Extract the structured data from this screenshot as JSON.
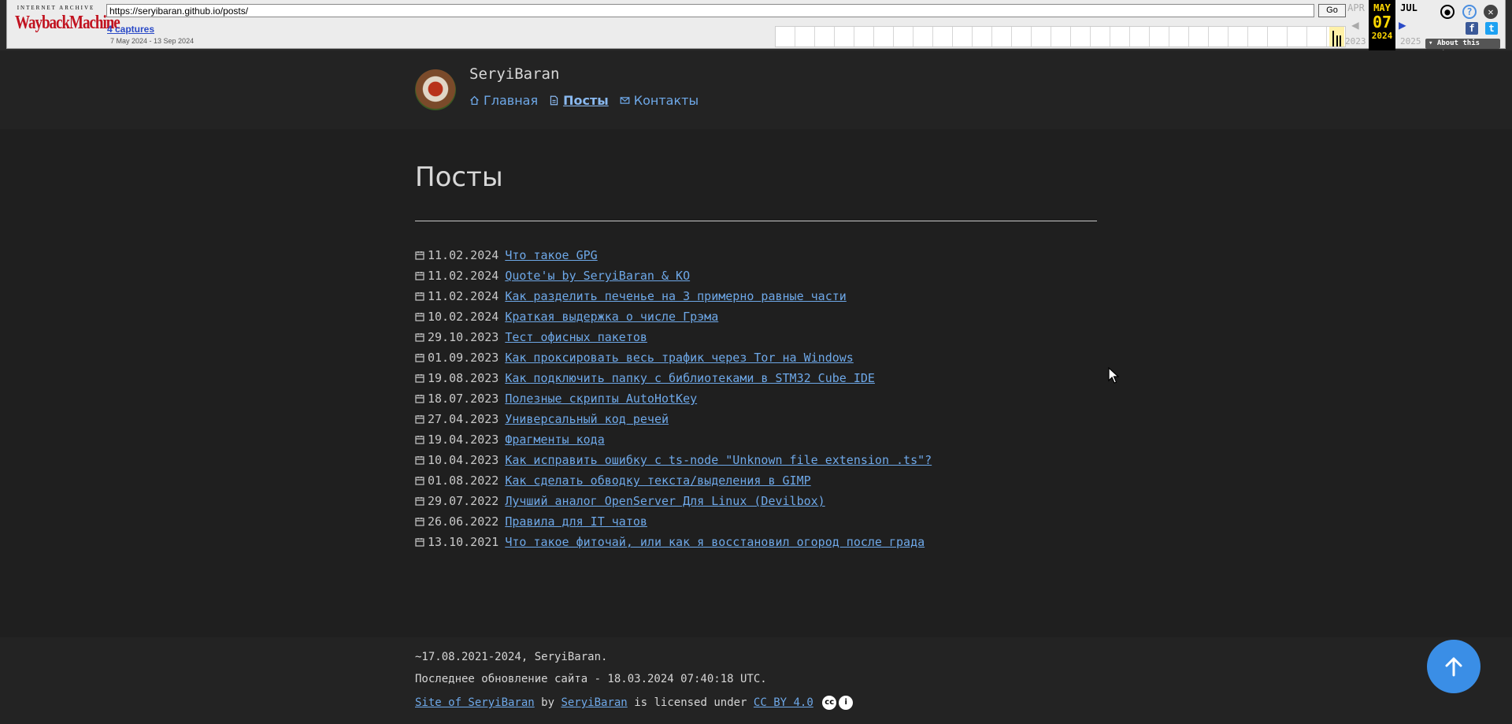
{
  "wayback": {
    "logo_top": "INTERNET ARCHIVE",
    "logo_main": "WaybackMachine",
    "url": "https://seryibaran.github.io/posts/",
    "go_label": "Go",
    "captures_link": "4 captures",
    "date_range": "7 May 2024 - 13 Sep 2024",
    "prev_month": "APR",
    "current_month": "MAY",
    "current_day": "07",
    "current_year": "2024",
    "next_month": "JUL",
    "prev_year": "2023",
    "next_year": "2025",
    "about_label": "About this capture",
    "help_icon_glyph": "?",
    "close_icon_glyph": "✕",
    "facebook_glyph": "f",
    "twitter_glyph": "t"
  },
  "site": {
    "title": "SeryiBaran",
    "nav": [
      {
        "label": "Главная",
        "icon": "home-icon",
        "active": false
      },
      {
        "label": "Посты",
        "icon": "document-icon",
        "active": true
      },
      {
        "label": "Контакты",
        "icon": "mail-icon",
        "active": false
      }
    ]
  },
  "main": {
    "heading": "Посты",
    "posts": [
      {
        "date": "11.02.2024",
        "title": "Что такое GPG"
      },
      {
        "date": "11.02.2024",
        "title": "Quote'ы by SeryiBaran & KO"
      },
      {
        "date": "11.02.2024",
        "title": "Как разделить печенье на 3 примерно равные части"
      },
      {
        "date": "10.02.2024",
        "title": "Краткая выдержка о числе Грэма"
      },
      {
        "date": "29.10.2023",
        "title": "Тест офисных пакетов"
      },
      {
        "date": "01.09.2023",
        "title": "Как проксировать весь трафик через Tor на Windows"
      },
      {
        "date": "19.08.2023",
        "title": "Как подключить папку с библиотеками в STM32 Cube IDE"
      },
      {
        "date": "18.07.2023",
        "title": "Полезные скрипты AutoHotKey"
      },
      {
        "date": "27.04.2023",
        "title": "Универсальный код речей"
      },
      {
        "date": "19.04.2023",
        "title": "Фрагменты кода"
      },
      {
        "date": "10.04.2023",
        "title": "Как исправить ошибку с ts-node \"Unknown file extension .ts\"?"
      },
      {
        "date": "01.08.2022",
        "title": "Как сделать обводку текста/выделения в GIMP"
      },
      {
        "date": "29.07.2022",
        "title": "Лучший аналог OpenServer Для Linux (Devilbox)"
      },
      {
        "date": "26.06.2022",
        "title": "Правила для IT чатов"
      },
      {
        "date": "13.10.2021",
        "title": "Что такое фиточай, или как я восстановил огород после града"
      }
    ]
  },
  "footer": {
    "copyright": "~17.08.2021-2024, SeryiBaran.",
    "last_update": "Последнее обновление сайта - 18.03.2024 07:40:18 UTC.",
    "license_site": "Site of SeryiBaran",
    "license_by": "by",
    "license_author": "SeryiBaran",
    "license_text": "is licensed under",
    "license_name": "CC BY 4.0",
    "cc_glyph": "cc",
    "by_glyph": "i"
  },
  "colors": {
    "background": "#1f1f1f",
    "header_bg": "#232323",
    "link": "#6ea8e8",
    "scroll_button": "#3a8ee6"
  }
}
